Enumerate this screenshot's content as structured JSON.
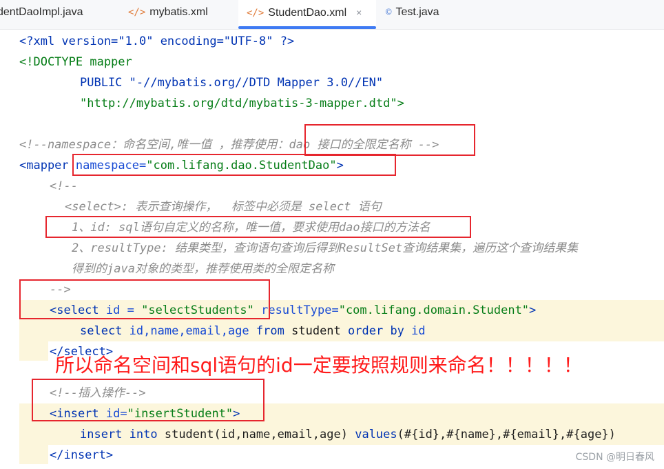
{
  "tabs": [
    {
      "label": "dentDaoImpl.java",
      "icon": "",
      "kind": "java"
    },
    {
      "label": "mybatis.xml",
      "icon": "</>",
      "kind": "xml"
    },
    {
      "label": "StudentDao.xml",
      "icon": "</>",
      "kind": "xml",
      "active": true,
      "close": "×"
    },
    {
      "label": "Test.java",
      "icon": "©",
      "kind": "java"
    }
  ],
  "code": {
    "l1": [
      "<?xml version=\"1.0\" encoding=\"UTF-8\" ?>"
    ],
    "l2": "<!DOCTYPE mapper",
    "l3": "PUBLIC \"-//mybatis.org//DTD Mapper 3.0//EN\"",
    "l4": "\"http://mybatis.org/dtd/mybatis-3-mapper.dtd\">",
    "l6": "<!--namespace：命名空间,唯一值 ，推荐使用：dao 接口的全限定名称 -->",
    "l7_tag": "<mapper",
    "l7_attr": "namespace=",
    "l7_val": "\"com.lifang.dao.StudentDao\"",
    "l7_end": ">",
    "l8": "<!--",
    "l9": "<select>: 表示查询操作，  标签中必须是 select 语句",
    "l10": "1、id: sql语句自定义的名称，唯一值，要求使用dao接口的方法名",
    "l11": "2、resultType: 结果类型，查询语句查询后得到ResultSet查询结果集，遍历这个查询结果集",
    "l12": "得到的java对象的类型，推荐使用类的全限定名称",
    "l13": "-->",
    "l14_tag": "<select",
    "l14_attr1": "id = ",
    "l14_val1": "\"selectStudents\"",
    "l14_attr2": "resultType=",
    "l14_val2": "\"com.lifang.domain.Student\"",
    "l14_end": ">",
    "l15_kw1": "select",
    "l15_cols": "id,name,email,age",
    "l15_kw2": "from",
    "l15_tbl": "student",
    "l15_kw3": "order by",
    "l15_col": "id",
    "l16": "</select>",
    "l18": "<!--插入操作-->",
    "l19_tag": "<insert",
    "l19_attr": "id=",
    "l19_val": "\"insertStudent\"",
    "l19_end": ">",
    "l20_kw1": "insert into",
    "l20_rest": "student(id,name,email,age)",
    "l20_kw2": "values",
    "l20_vals": "(#{id},#{name},#{email},#{age})",
    "l21": "</insert>"
  },
  "annotation": "所以命名空间和sql语句的id一定要按照规则来命名！！！！！",
  "watermark": "CSDN @明日春风",
  "colors": {
    "tag": "#0033b3",
    "string": "#067d17",
    "comment": "#8c8c8c",
    "highlight_box": "#e6262e",
    "annotation": "#ff1a1a",
    "active_tab_underline": "#3f7bf3"
  }
}
